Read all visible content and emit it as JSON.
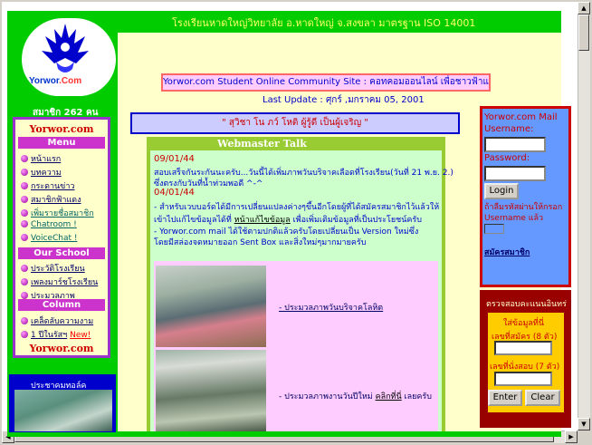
{
  "header": {
    "school_line": "โรงเรียนหาดใหญ่วิทยาลัย อ.หาดใหญ่ จ.สงขลา มาตรฐาน ISO 14001",
    "logo_text_a": "Yorwor",
    "logo_text_b": ".Com",
    "members": "สมาชิก 262 คน",
    "community": "Yorwor.com Student Online Community Site : คอทคอมออนไลน์ เพื่อชาวฟ้าแดง",
    "last_update": "Last Update : ศุกร์ ,มกราคม 05, 2001",
    "quote": "\" สุวิชา โน ภว์ โหติ ผู้รู้ดี เป็นผู้เจริญ \""
  },
  "left_menu": {
    "site_name_top": "Yorwor.com",
    "section_menu": "Menu",
    "menu_items": [
      "หน้าแรก",
      "บทความ",
      "กระดานข่าว",
      "สมาชิกฟ้าแดง",
      "เพิ่มรายชื่อสมาชิก",
      "Chatroom !",
      "VoiceChat !"
    ],
    "section_school": "Our School",
    "school_items": [
      "ประวัติโรงเรียน",
      "เพลงมาร์ชโรงเรียน",
      "ประมวลภาพ"
    ],
    "section_column": "Column",
    "column_items": [
      "เคล็ดลับความงาม",
      "1 ปีในรัสฯ"
    ],
    "new_badge": "New!",
    "site_name_bottom": "Yorwor.com",
    "bottom_pic_title": "ประชาคมทอล์ค"
  },
  "webmaster": {
    "title": "Webmaster Talk",
    "date1": "09/01/44",
    "msg1_line1": "สอบเสร็จกันระกันนะครับ...วันนี้ได้เพิ่มภาพวันบริจาคเลือดที่โรงเรียน(วันที่ 21 พ.ย. 2.)",
    "msg1_line2": "ซึ่งตรงกับวันที่น้ำท่วมพอดี ^-^",
    "date2": "04/01/44",
    "msg2_line1": "- สำหรับเวบบอร์ดได้มีการเปลี่ยนแปลงค่างๆขึ้นอีกโดยผู้ที่ได้สมัครสมาชิกไว้แล้วให้",
    "msg2_line2_a": "เข้าไปแก้ไขข้อมูลได้ที่ ",
    "msg2_link": "หน้าแก้ไขข้อมูล",
    "msg2_line2_b": " เพื่อเพิ่มเติมข้อมูลที่เป็นประโยชน์ครับ",
    "msg3_line1": "- Yorwor.com mail ได้ใช้ตามปกติแล้วครับโดยเปลี่ยนเป็น Version ใหม่ซึ่ง",
    "msg3_line2": "โดยมีสล่องจดหมายออก Sent Box และสิ่งใหม่ๆมากมายครับ",
    "photo1_caption": "- ประมวลภาพวันบริจาคโลหิต",
    "photo2_caption_a": "- ประมวลภาพงานวันปีใหม่ ",
    "photo2_link": "คลิกที่นี่",
    "photo2_caption_b": " เลยครับ"
  },
  "login": {
    "title": "Yorwor.com Mail",
    "username_label": "Username:",
    "username_value": "",
    "password_label": "Password:",
    "password_value": "",
    "login_button": "Login",
    "forgot_text": "ถ้าลืมรหัสผ่านให้กรอก Username แล้ว",
    "register_link": "สมัครสมาชิก"
  },
  "score": {
    "title": "ตรวจสอบคะแนนอินทร่",
    "instruction": "ใส่ข้อมูลที่นี่",
    "student_id_label": "เลขที่สมัคร (8 ตัว)",
    "student_id_value": "",
    "exam_id_label": "เลขที่นั่งสอบ (7 ตัว)",
    "exam_id_value": "",
    "enter_button": "Enter",
    "clear_button": "Clear"
  },
  "colors": {
    "page_green": "#00cc00",
    "cream": "#ffffcc",
    "menu_border": "#9933cc",
    "menu_bar": "#cc33cc",
    "login_bg": "#6699ff",
    "score_bg": "#990000"
  }
}
